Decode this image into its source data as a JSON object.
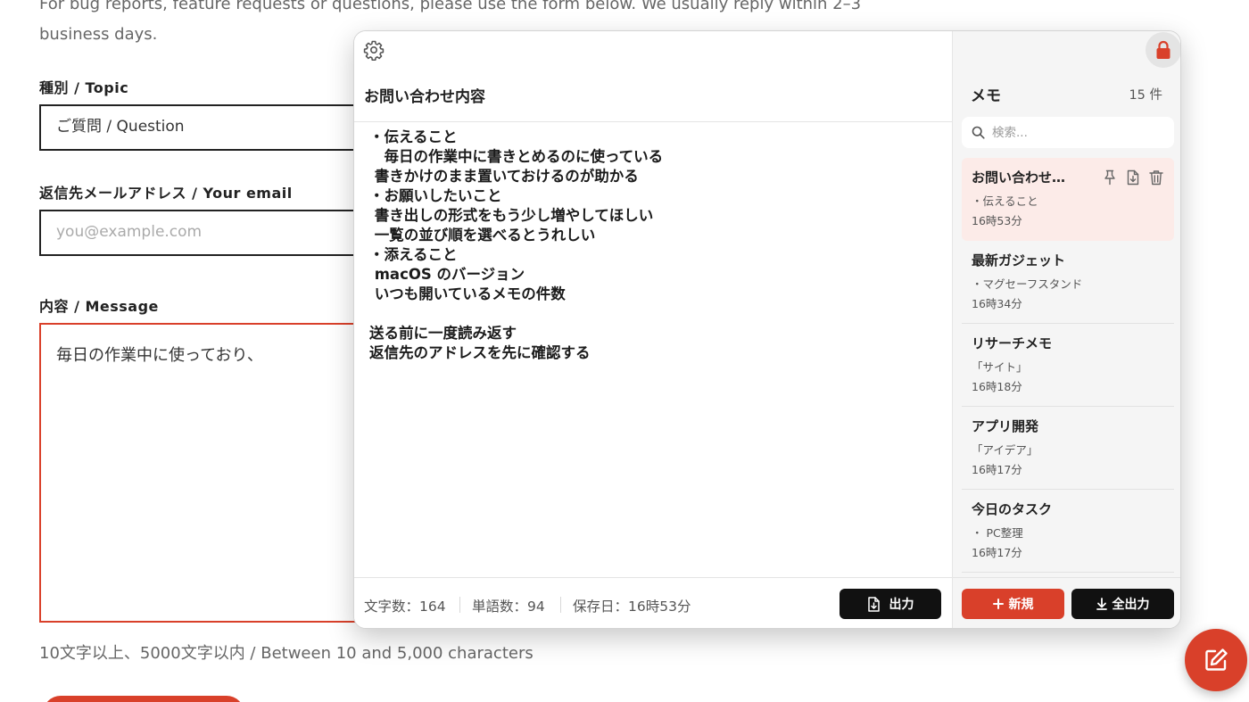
{
  "form": {
    "intro_line1": "For bug reports, feature requests or questions, please use the form below. We usually reply within 2–3",
    "intro_line2": "business days.",
    "topic_label": "種別 / Topic",
    "topic_value": "ご質問 / Question",
    "email_label": "返信先メールアドレス / Your email",
    "email_placeholder": "you@example.com",
    "message_label": "内容 / Message",
    "message_value": "毎日の作業中に使っており、",
    "message_hint": "10文字以上、5000文字以内 / Between 10 and 5,000 characters"
  },
  "panel": {
    "editor": {
      "gear_icon": "gear-icon",
      "title": "お問い合わせ内容",
      "body_lines": [
        "・伝えること",
        "　毎日の作業中に書きとめるのに使っている",
        " 書きかけのまま置いておけるのが助かる",
        "・お願いしたいこと",
        " 書き出しの形式をもう少し増やしてほしい",
        " 一覧の並び順を選べるとうれしい",
        "・添えること",
        " macOS のバージョン",
        " いつも開いているメモの件数",
        "",
        "送る前に一度読み返す",
        "返信先のアドレスを先に確認する"
      ],
      "char_count": "文字数：164",
      "word_count": "単語数：94",
      "saved_time": "保存日：16時53分",
      "export_label": "出力"
    },
    "sidebar": {
      "lock_icon": "lock-icon",
      "title": "メモ",
      "count": "15 件",
      "search_placeholder": "検索...",
      "memos": [
        {
          "title": "お問い合わせ内容",
          "preview": "・伝えること",
          "time": "16時53分"
        },
        {
          "title": "最新ガジェット",
          "preview": "・マグセーフスタンド",
          "time": "16時34分"
        },
        {
          "title": "リサーチメモ",
          "preview": "「サイト」",
          "time": "16時18分"
        },
        {
          "title": "アプリ開発",
          "preview": "「アイデア」",
          "time": "16時17分"
        },
        {
          "title": "今日のタスク",
          "preview": "・ PC整理",
          "time": "16時17分"
        }
      ],
      "new_label": "新規",
      "export_all_label": "全出力"
    }
  },
  "colors": {
    "accent": "#d9402a",
    "active_memo_bg": "#fcebe8",
    "dark_button": "#111111"
  }
}
